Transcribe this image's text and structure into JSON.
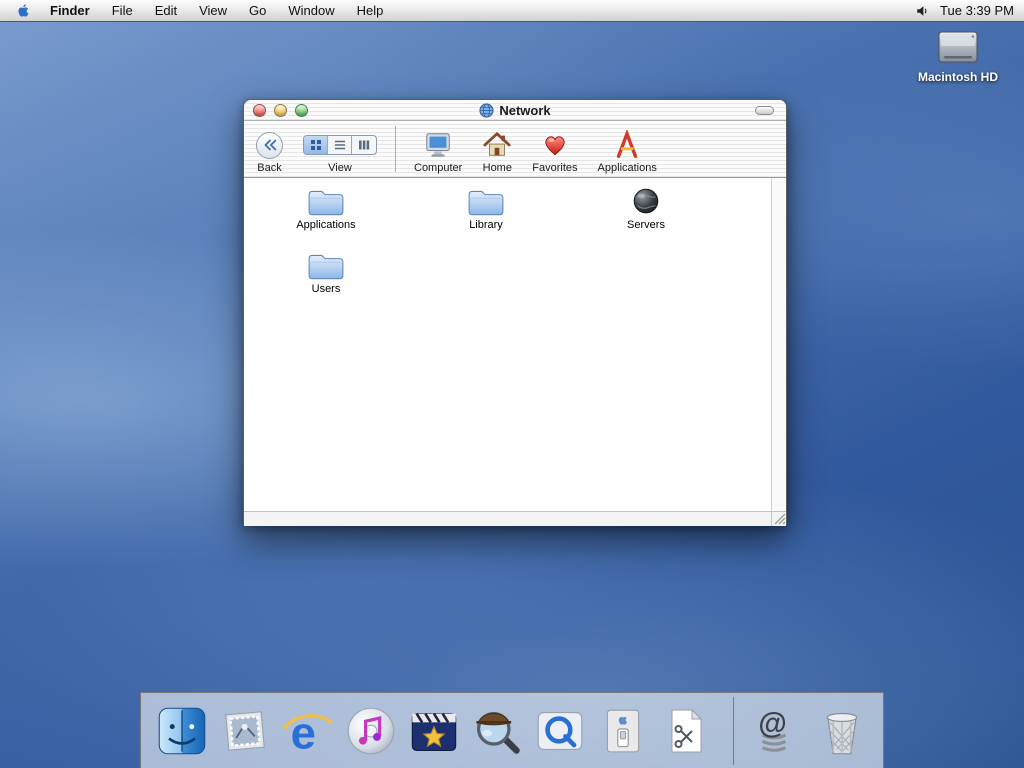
{
  "menu_bar": {
    "items": [
      {
        "label": "Finder"
      },
      {
        "label": "File"
      },
      {
        "label": "Edit"
      },
      {
        "label": "View"
      },
      {
        "label": "Go"
      },
      {
        "label": "Window"
      },
      {
        "label": "Help"
      }
    ],
    "clock": "Tue 3:39 PM"
  },
  "desktop": {
    "icons": [
      {
        "label": "Macintosh HD",
        "icon": "hard-drive-icon"
      }
    ]
  },
  "window": {
    "title": "Network",
    "title_icon": "network-globe-icon",
    "toolbar": {
      "back": "Back",
      "view": "View",
      "view_modes": [
        "icon-view",
        "list-view",
        "column-view"
      ],
      "view_selected": "icon-view",
      "shortcuts": [
        {
          "label": "Computer",
          "icon": "computer-icon"
        },
        {
          "label": "Home",
          "icon": "home-icon"
        },
        {
          "label": "Favorites",
          "icon": "favorites-heart-icon"
        },
        {
          "label": "Applications",
          "icon": "applications-a-icon"
        }
      ]
    },
    "items": [
      {
        "label": "Applications",
        "icon": "folder-icon"
      },
      {
        "label": "Library",
        "icon": "folder-icon"
      },
      {
        "label": "Servers",
        "icon": "servers-globe-icon"
      },
      {
        "label": "Users",
        "icon": "folder-icon"
      }
    ]
  },
  "dock": {
    "items": [
      {
        "name": "finder-icon"
      },
      {
        "name": "mail-icon"
      },
      {
        "name": "internet-explorer-icon"
      },
      {
        "name": "itunes-icon"
      },
      {
        "name": "imovie-icon"
      },
      {
        "name": "sherlock-icon"
      },
      {
        "name": "quicktime-icon"
      },
      {
        "name": "system-preferences-icon"
      },
      {
        "name": "clippings-document-icon"
      },
      {
        "name": "web-link-spring-icon"
      },
      {
        "name": "trash-icon"
      }
    ]
  },
  "colors": {
    "desktop_blue": "#3b67a8",
    "traffic_red": "#e33e32",
    "traffic_yellow": "#f0ad2a",
    "traffic_green": "#2dac3a",
    "folder_blue": "#8db6e6"
  }
}
